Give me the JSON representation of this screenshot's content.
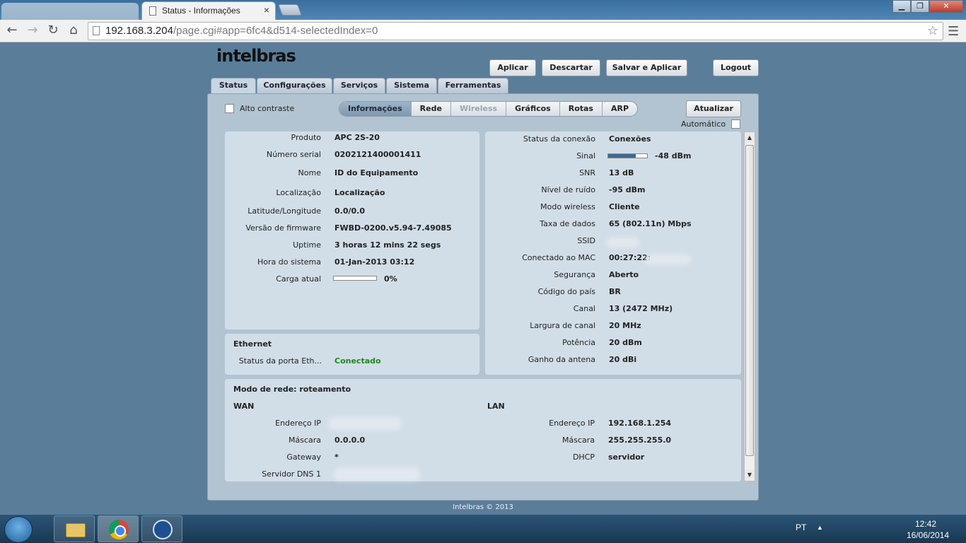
{
  "browser": {
    "tab_title": "Status - Informações",
    "url_host": "192.168.3.204",
    "url_path": "/page.cgi#app=6fc4&d514-selectedIndex=0",
    "close_glyph": "×"
  },
  "window_controls": {
    "minimize": "▁",
    "maximize": "❐",
    "close": "✕"
  },
  "nav": {
    "back": "←",
    "forward": "→",
    "reload": "↻",
    "home": "⌂",
    "star": "☆",
    "menu": "☰"
  },
  "logo": "intelbras",
  "actions": {
    "apply": "Aplicar",
    "discard": "Descartar",
    "save_apply": "Salvar e Aplicar",
    "logout": "Logout"
  },
  "main_tabs": [
    "Status",
    "Configurações",
    "Serviços",
    "Sistema",
    "Ferramentas"
  ],
  "contrast_label": "Alto contraste",
  "sub_tabs": [
    "Informações",
    "Rede",
    "Wireless",
    "Gráficos",
    "Rotas",
    "ARP"
  ],
  "refresh": {
    "label": "Atualizar",
    "auto_label": "Automático"
  },
  "device": [
    {
      "label": "Produto",
      "value": "APC 2S-20"
    },
    {
      "label": "Número serial",
      "value": "0202121400001411"
    },
    {
      "label": "Nome",
      "value": "ID do Equipamento"
    },
    {
      "label": "Localização",
      "value": "Localização"
    },
    {
      "label": "Latitude/Longitude",
      "value": "0.0/0.0"
    },
    {
      "label": "Versão de firmware",
      "value": "FWBD-0200.v5.94-7.49085"
    },
    {
      "label": "Uptime",
      "value": "3 horas 12 mins 22 segs"
    },
    {
      "label": "Hora do sistema",
      "value": "01-Jan-2013 03:12"
    },
    {
      "label": "Carga atual",
      "value": "0%",
      "load_fraction": 0.0
    }
  ],
  "ethernet": {
    "title": "Ethernet",
    "label": "Status da porta Eth...",
    "value": "Conectado",
    "status_color": "#1a8a1a"
  },
  "wireless": [
    {
      "label": "Status da conexão",
      "value": "Conexões"
    },
    {
      "label": "Sinal",
      "value": "-48 dBm",
      "signal_fraction": 0.7
    },
    {
      "label": "SNR",
      "value": "13 dB"
    },
    {
      "label": "Nível de ruído",
      "value": "-95 dBm"
    },
    {
      "label": "Modo wireless",
      "value": "Cliente"
    },
    {
      "label": "Taxa de dados",
      "value": "65 (802.11n) Mbps"
    },
    {
      "label": "SSID",
      "value": ""
    },
    {
      "label": "Conectado ao MAC",
      "value": "00:27:22:"
    },
    {
      "label": "Segurança",
      "value": "Aberto"
    },
    {
      "label": "Código do país",
      "value": "BR"
    },
    {
      "label": "Canal",
      "value": "13 (2472 MHz)"
    },
    {
      "label": "Largura de canal",
      "value": "20 MHz"
    },
    {
      "label": "Potência",
      "value": "20 dBm"
    },
    {
      "label": "Ganho da antena",
      "value": "20 dBi"
    }
  ],
  "network": {
    "mode": "Modo de rede: roteamento",
    "wan_title": "WAN",
    "lan_title": "LAN",
    "wan": [
      {
        "label": "Endereço IP",
        "value": ""
      },
      {
        "label": "Máscara",
        "value": "0.0.0.0"
      },
      {
        "label": "Gateway",
        "value": "*"
      },
      {
        "label": "Servidor DNS 1",
        "value": ""
      }
    ],
    "lan": [
      {
        "label": "Endereço IP",
        "value": "192.168.1.254"
      },
      {
        "label": "Máscara",
        "value": "255.255.255.0"
      },
      {
        "label": "DHCP",
        "value": "servidor"
      }
    ]
  },
  "footer": "Intelbras © 2013",
  "scroll": {
    "up": "▲",
    "down": "▼"
  },
  "taskbar": {
    "lang": "PT",
    "time": "12:42",
    "date": "16/06/2014",
    "tray_up": "▲"
  }
}
